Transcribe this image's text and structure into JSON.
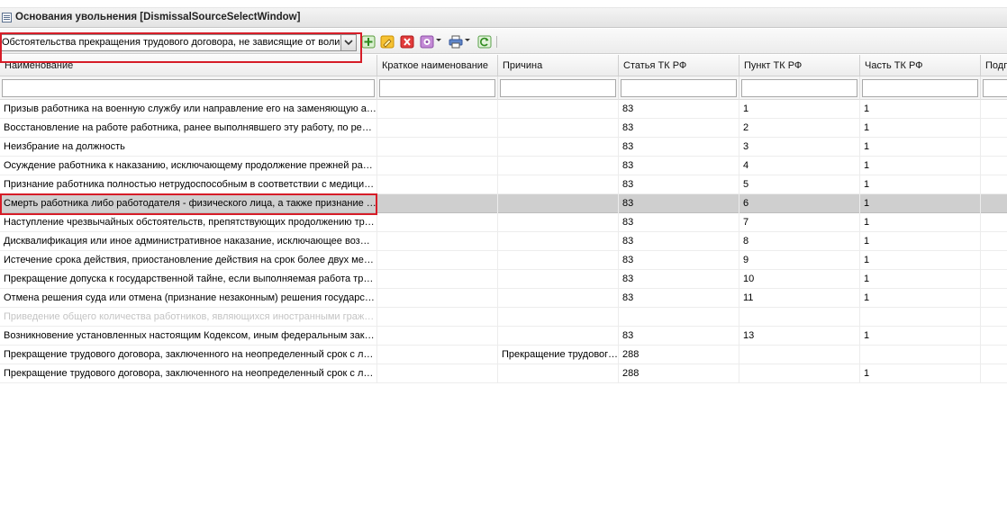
{
  "window": {
    "title": "Основания увольнения [DismissalSourceSelectWindow]"
  },
  "toolbar": {
    "combo_value": "Обстоятельства прекращения трудового договора, не зависящие от воли сторон",
    "buttons": [
      {
        "name": "add-button",
        "icon": "green-plus-icon",
        "color": "#3a9a2a"
      },
      {
        "name": "edit-button",
        "icon": "pencil-icon",
        "color": "#e0a000"
      },
      {
        "name": "delete-button",
        "icon": "red-x-icon",
        "color": "#d62d2d"
      },
      {
        "name": "settings-button",
        "icon": "gear-icon",
        "color": "#a85fc0"
      },
      {
        "name": "print-button",
        "icon": "printer-icon",
        "color": "#4a73b8"
      },
      {
        "name": "refresh-button",
        "icon": "refresh-icon",
        "color": "#3aa33a"
      }
    ]
  },
  "grid": {
    "columns": [
      {
        "key": "name",
        "label": "Наименование"
      },
      {
        "key": "short_name",
        "label": "Краткое наименование"
      },
      {
        "key": "reason",
        "label": "Причина"
      },
      {
        "key": "article",
        "label": "Статья ТК РФ"
      },
      {
        "key": "item",
        "label": "Пункт ТК РФ"
      },
      {
        "key": "part",
        "label": "Часть ТК РФ"
      },
      {
        "key": "sub",
        "label": "Подп"
      }
    ],
    "rows": [
      {
        "name": "Призыв работника на военную службу или направление его на заменяющую альтернативную гражданскую службу",
        "short_name": "",
        "reason": "",
        "article": "83",
        "item": "1",
        "part": "1",
        "sub": "",
        "state": "normal"
      },
      {
        "name": "Восстановление на работе работника, ранее выполнявшего эту работу, по решению государственной инспекции труда или суда",
        "short_name": "",
        "reason": "",
        "article": "83",
        "item": "2",
        "part": "1",
        "sub": "",
        "state": "normal"
      },
      {
        "name": "Неизбрание на должность",
        "short_name": "",
        "reason": "",
        "article": "83",
        "item": "3",
        "part": "1",
        "sub": "",
        "state": "normal"
      },
      {
        "name": "Осуждение работника к наказанию, исключающему продолжение прежней работы",
        "short_name": "",
        "reason": "",
        "article": "83",
        "item": "4",
        "part": "1",
        "sub": "",
        "state": "normal"
      },
      {
        "name": "Признание работника полностью нетрудоспособным в соответствии с медицинским заключением",
        "short_name": "",
        "reason": "",
        "article": "83",
        "item": "5",
        "part": "1",
        "sub": "",
        "state": "normal"
      },
      {
        "name": "Смерть работника либо работодателя - физического лица, а также признание судом работника либо работодателя умершим",
        "short_name": "",
        "reason": "",
        "article": "83",
        "item": "6",
        "part": "1",
        "sub": "",
        "state": "selected"
      },
      {
        "name": "Наступление чрезвычайных обстоятельств, препятствующих продолжению трудовых отношений",
        "short_name": "",
        "reason": "",
        "article": "83",
        "item": "7",
        "part": "1",
        "sub": "",
        "state": "normal"
      },
      {
        "name": "Дисквалификация или иное административное наказание, исключающее возможность исполнения работником обязанностей",
        "short_name": "",
        "reason": "",
        "article": "83",
        "item": "8",
        "part": "1",
        "sub": "",
        "state": "normal"
      },
      {
        "name": "Истечение срока действия, приостановление действия на срок более двух месяцев",
        "short_name": "",
        "reason": "",
        "article": "83",
        "item": "9",
        "part": "1",
        "sub": "",
        "state": "normal"
      },
      {
        "name": "Прекращение допуска к государственной тайне, если выполняемая работа требует такого допуска",
        "short_name": "",
        "reason": "",
        "article": "83",
        "item": "10",
        "part": "1",
        "sub": "",
        "state": "normal"
      },
      {
        "name": "Отмена решения суда или отмена (признание незаконным) решения государственной инспекции труда",
        "short_name": "",
        "reason": "",
        "article": "83",
        "item": "11",
        "part": "1",
        "sub": "",
        "state": "normal"
      },
      {
        "name": "Приведение общего количества работников, являющихся иностранными гражданами",
        "short_name": "",
        "reason": "",
        "article": "",
        "item": "",
        "part": "",
        "sub": "",
        "state": "disabled"
      },
      {
        "name": "Возникновение установленных настоящим Кодексом, иным федеральным законом ограничений",
        "short_name": "",
        "reason": "",
        "article": "83",
        "item": "13",
        "part": "1",
        "sub": "",
        "state": "normal"
      },
      {
        "name": "Прекращение трудового договора, заключенного на неопределенный срок с лицом",
        "short_name": "",
        "reason": "Прекращение трудового договора",
        "article": "288",
        "item": "",
        "part": "",
        "sub": "",
        "state": "normal"
      },
      {
        "name": "Прекращение трудового договора, заключенного на неопределенный срок с лицом",
        "short_name": "",
        "reason": "",
        "article": "288",
        "item": "",
        "part": "1",
        "sub": "",
        "state": "normal"
      }
    ]
  }
}
